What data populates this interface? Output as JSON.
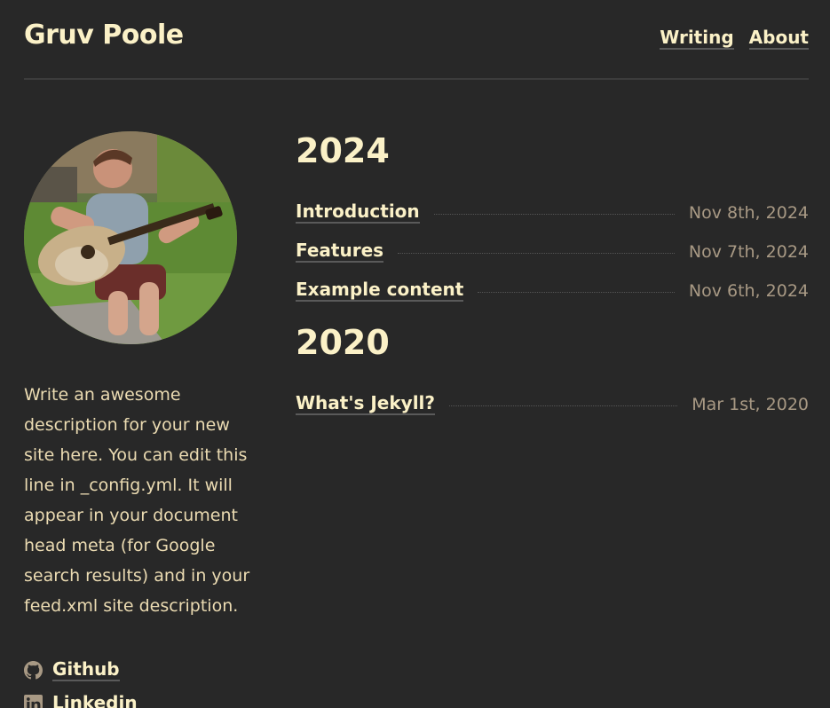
{
  "header": {
    "site_title": "Gruv Poole",
    "nav": [
      {
        "label": "Writing"
      },
      {
        "label": "About"
      }
    ]
  },
  "sidebar": {
    "description": "Write an awesome description for your new site here. You can edit this line in _config.yml. It will appear in your document head meta (for Google search results) and in your feed.xml site description.",
    "social": [
      {
        "label": "Github",
        "icon": "github-icon"
      },
      {
        "label": "Linkedin",
        "icon": "linkedin-icon"
      }
    ]
  },
  "archive": [
    {
      "year": "2024",
      "posts": [
        {
          "title": "Introduction",
          "date": "Nov 8th, 2024"
        },
        {
          "title": "Features",
          "date": "Nov 7th, 2024"
        },
        {
          "title": "Example content",
          "date": "Nov 6th, 2024"
        }
      ]
    },
    {
      "year": "2020",
      "posts": [
        {
          "title": "What's Jekyll?",
          "date": "Mar 1st, 2020"
        }
      ]
    }
  ]
}
